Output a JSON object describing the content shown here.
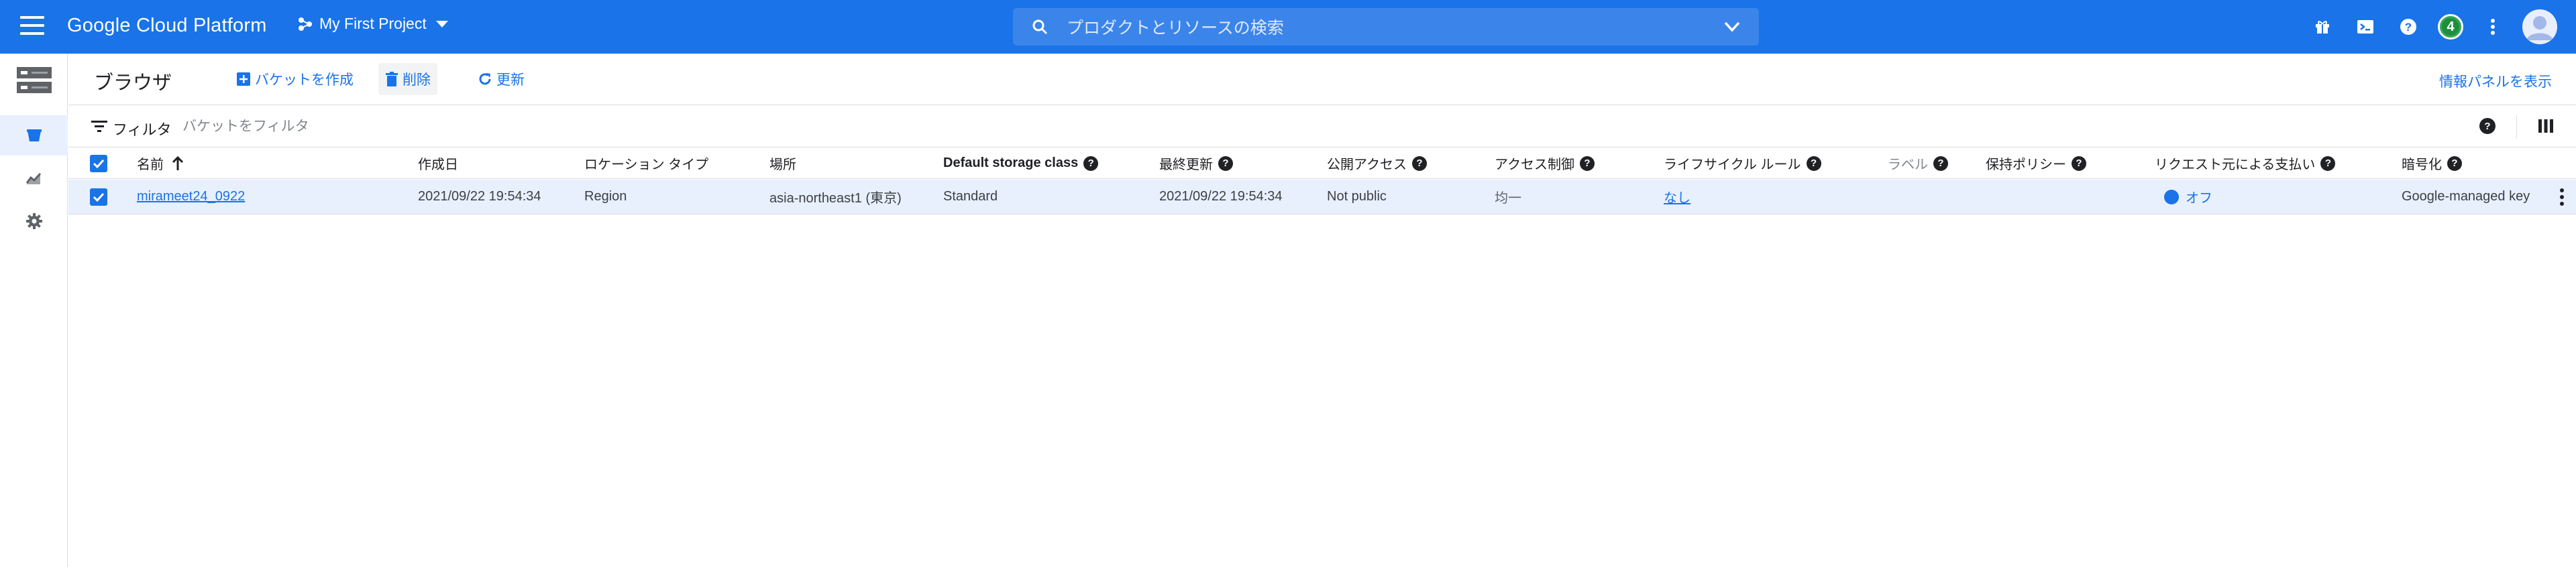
{
  "topbar": {
    "brand": "Google Cloud Platform",
    "project": "My First Project",
    "search_placeholder": "プロダクトとリソースの検索",
    "notifications_count": "4",
    "colors": {
      "bar": "#1a73e8",
      "search": "#3b85ea",
      "badge": "#1e8e3e"
    }
  },
  "actionbar": {
    "title": "ブラウザ",
    "create_bucket": "バケットを作成",
    "delete": "削除",
    "refresh": "更新",
    "info_panel": "情報パネルを表示"
  },
  "filter": {
    "label": "フィルタ",
    "placeholder": "バケットをフィルタ"
  },
  "table": {
    "headers": {
      "name": "名前",
      "created": "作成日",
      "location_type": "ロケーション タイプ",
      "location": "場所",
      "storage_class": "Default storage class",
      "updated": "最終更新",
      "public_access": "公開アクセス",
      "access_control": "アクセス制御",
      "lifecycle": "ライフサイクル ルール",
      "labels": "ラベル",
      "retention": "保持ポリシー",
      "requester_pays": "リクエスト元による支払い",
      "encryption": "暗号化"
    },
    "rows": [
      {
        "name": "mirameet24_0922",
        "created": "2021/09/22 19:54:34",
        "location_type": "Region",
        "location": "asia-northeast1 (東京)",
        "storage_class": "Standard",
        "updated": "2021/09/22 19:54:34",
        "public_access": "Not public",
        "access_control": "均一",
        "lifecycle": "なし",
        "requester_pays": "オフ",
        "encryption": "Google-managed key"
      }
    ]
  }
}
